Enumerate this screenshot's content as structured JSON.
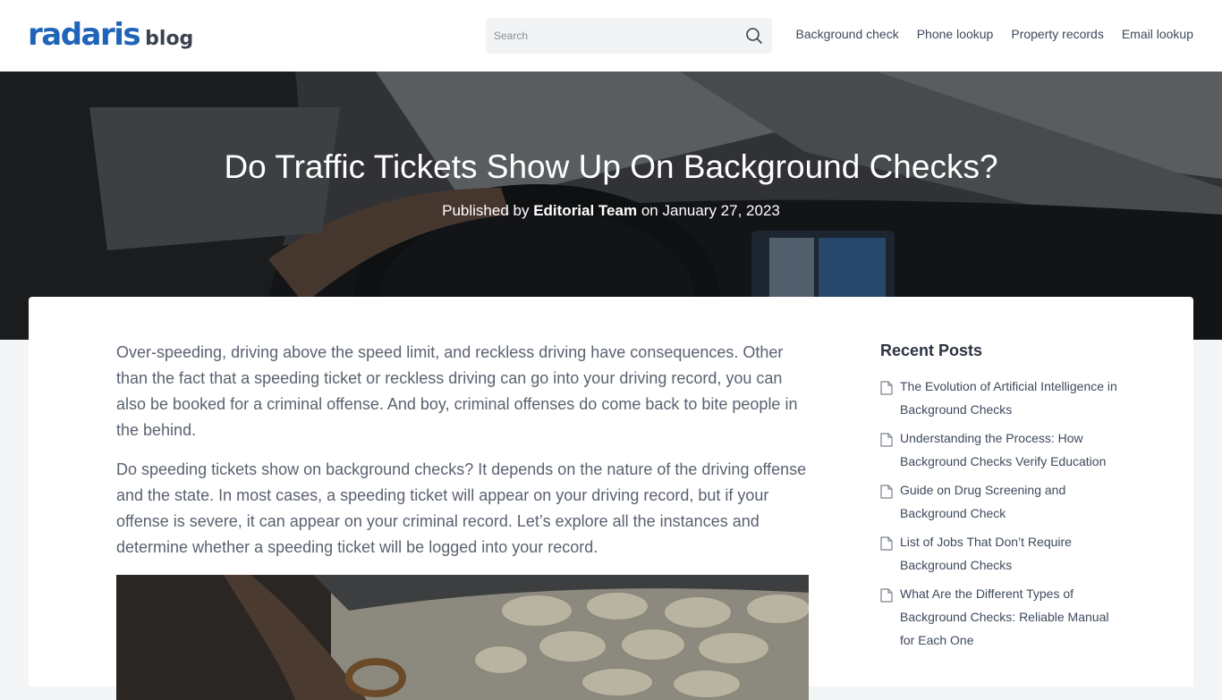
{
  "logo": {
    "main": "radaris",
    "sub": "blog"
  },
  "search": {
    "placeholder": "Search",
    "value": ""
  },
  "nav": [
    {
      "label": "Background check"
    },
    {
      "label": "Phone lookup"
    },
    {
      "label": "Property records"
    },
    {
      "label": "Email lookup"
    }
  ],
  "hero": {
    "title": "Do Traffic Tickets Show Up On Background Checks?",
    "published_prefix": "Published by",
    "author": "Editorial Team",
    "date_prefix": "on",
    "date": "January 27, 2023"
  },
  "article": {
    "paragraphs": [
      "Over-speeding, driving above the speed limit, and reckless driving have consequences. Other than the fact that a speeding ticket or reckless driving can go into your driving record, you can also be booked for a criminal offense. And boy, criminal offenses do come back to bite people in the behind.",
      "Do speeding tickets show on background checks? It depends on the nature of the driving offense and the state. In most cases, a speeding ticket will appear on your driving record, but if your offense is severe, it can appear on your criminal record. Let’s explore all the instances and determine whether a speeding ticket will be logged into your record."
    ]
  },
  "sidebar": {
    "heading": "Recent Posts",
    "posts": [
      {
        "title": "The Evolution of Artificial Intelligence in Background Checks"
      },
      {
        "title": "Understanding the Process: How Background Checks Verify Education"
      },
      {
        "title": "Guide on Drug Screening and Background Check"
      },
      {
        "title": "List of Jobs That Don’t Require Background Checks"
      },
      {
        "title": "What Are the Different Types of Background Checks: Reliable Manual for Each One"
      }
    ]
  },
  "colors": {
    "brand": "#1f64b8",
    "text": "#5a6270",
    "link": "#3d4a5c"
  }
}
